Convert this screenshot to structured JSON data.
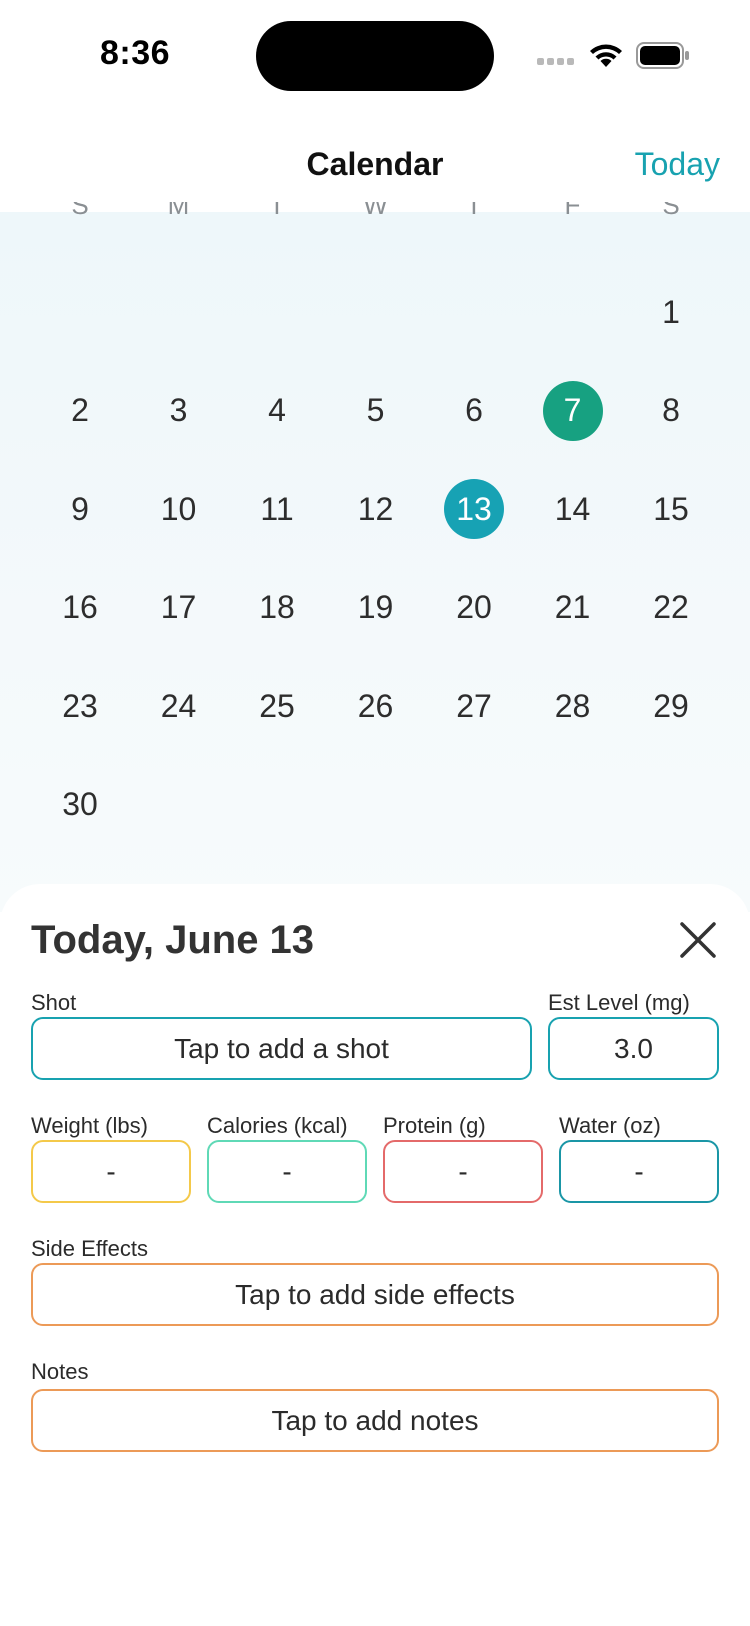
{
  "status_bar": {
    "time": "8:36"
  },
  "nav": {
    "title": "Calendar",
    "today_button": "Today"
  },
  "calendar": {
    "weekdays": [
      "S",
      "M",
      "T",
      "W",
      "T",
      "F",
      "S"
    ],
    "first_weekday_index": 6,
    "days_in_month": 30,
    "shot_day": 7,
    "selected_day": 13
  },
  "sheet": {
    "title": "Today, June 13",
    "shot": {
      "label": "Shot",
      "value": "Tap to add a shot"
    },
    "est_level": {
      "label": "Est Level (mg)",
      "value": "3.0"
    },
    "weight": {
      "label": "Weight (lbs)",
      "value": "-"
    },
    "calories": {
      "label": "Calories (kcal)",
      "value": "-"
    },
    "protein": {
      "label": "Protein (g)",
      "value": "-"
    },
    "water": {
      "label": "Water (oz)",
      "value": "-"
    },
    "side_effects": {
      "label": "Side Effects",
      "value": "Tap to add side effects"
    },
    "notes": {
      "label": "Notes",
      "value": "Tap to add notes"
    }
  },
  "colors": {
    "accent": "#18a2b0",
    "shot_day": "#17a181",
    "weight_border": "#f4c94a",
    "calories_border": "#5fd9b6",
    "protein_border": "#e46a6a",
    "water_border": "#1a96a6",
    "notes_border": "#ec9a57"
  }
}
